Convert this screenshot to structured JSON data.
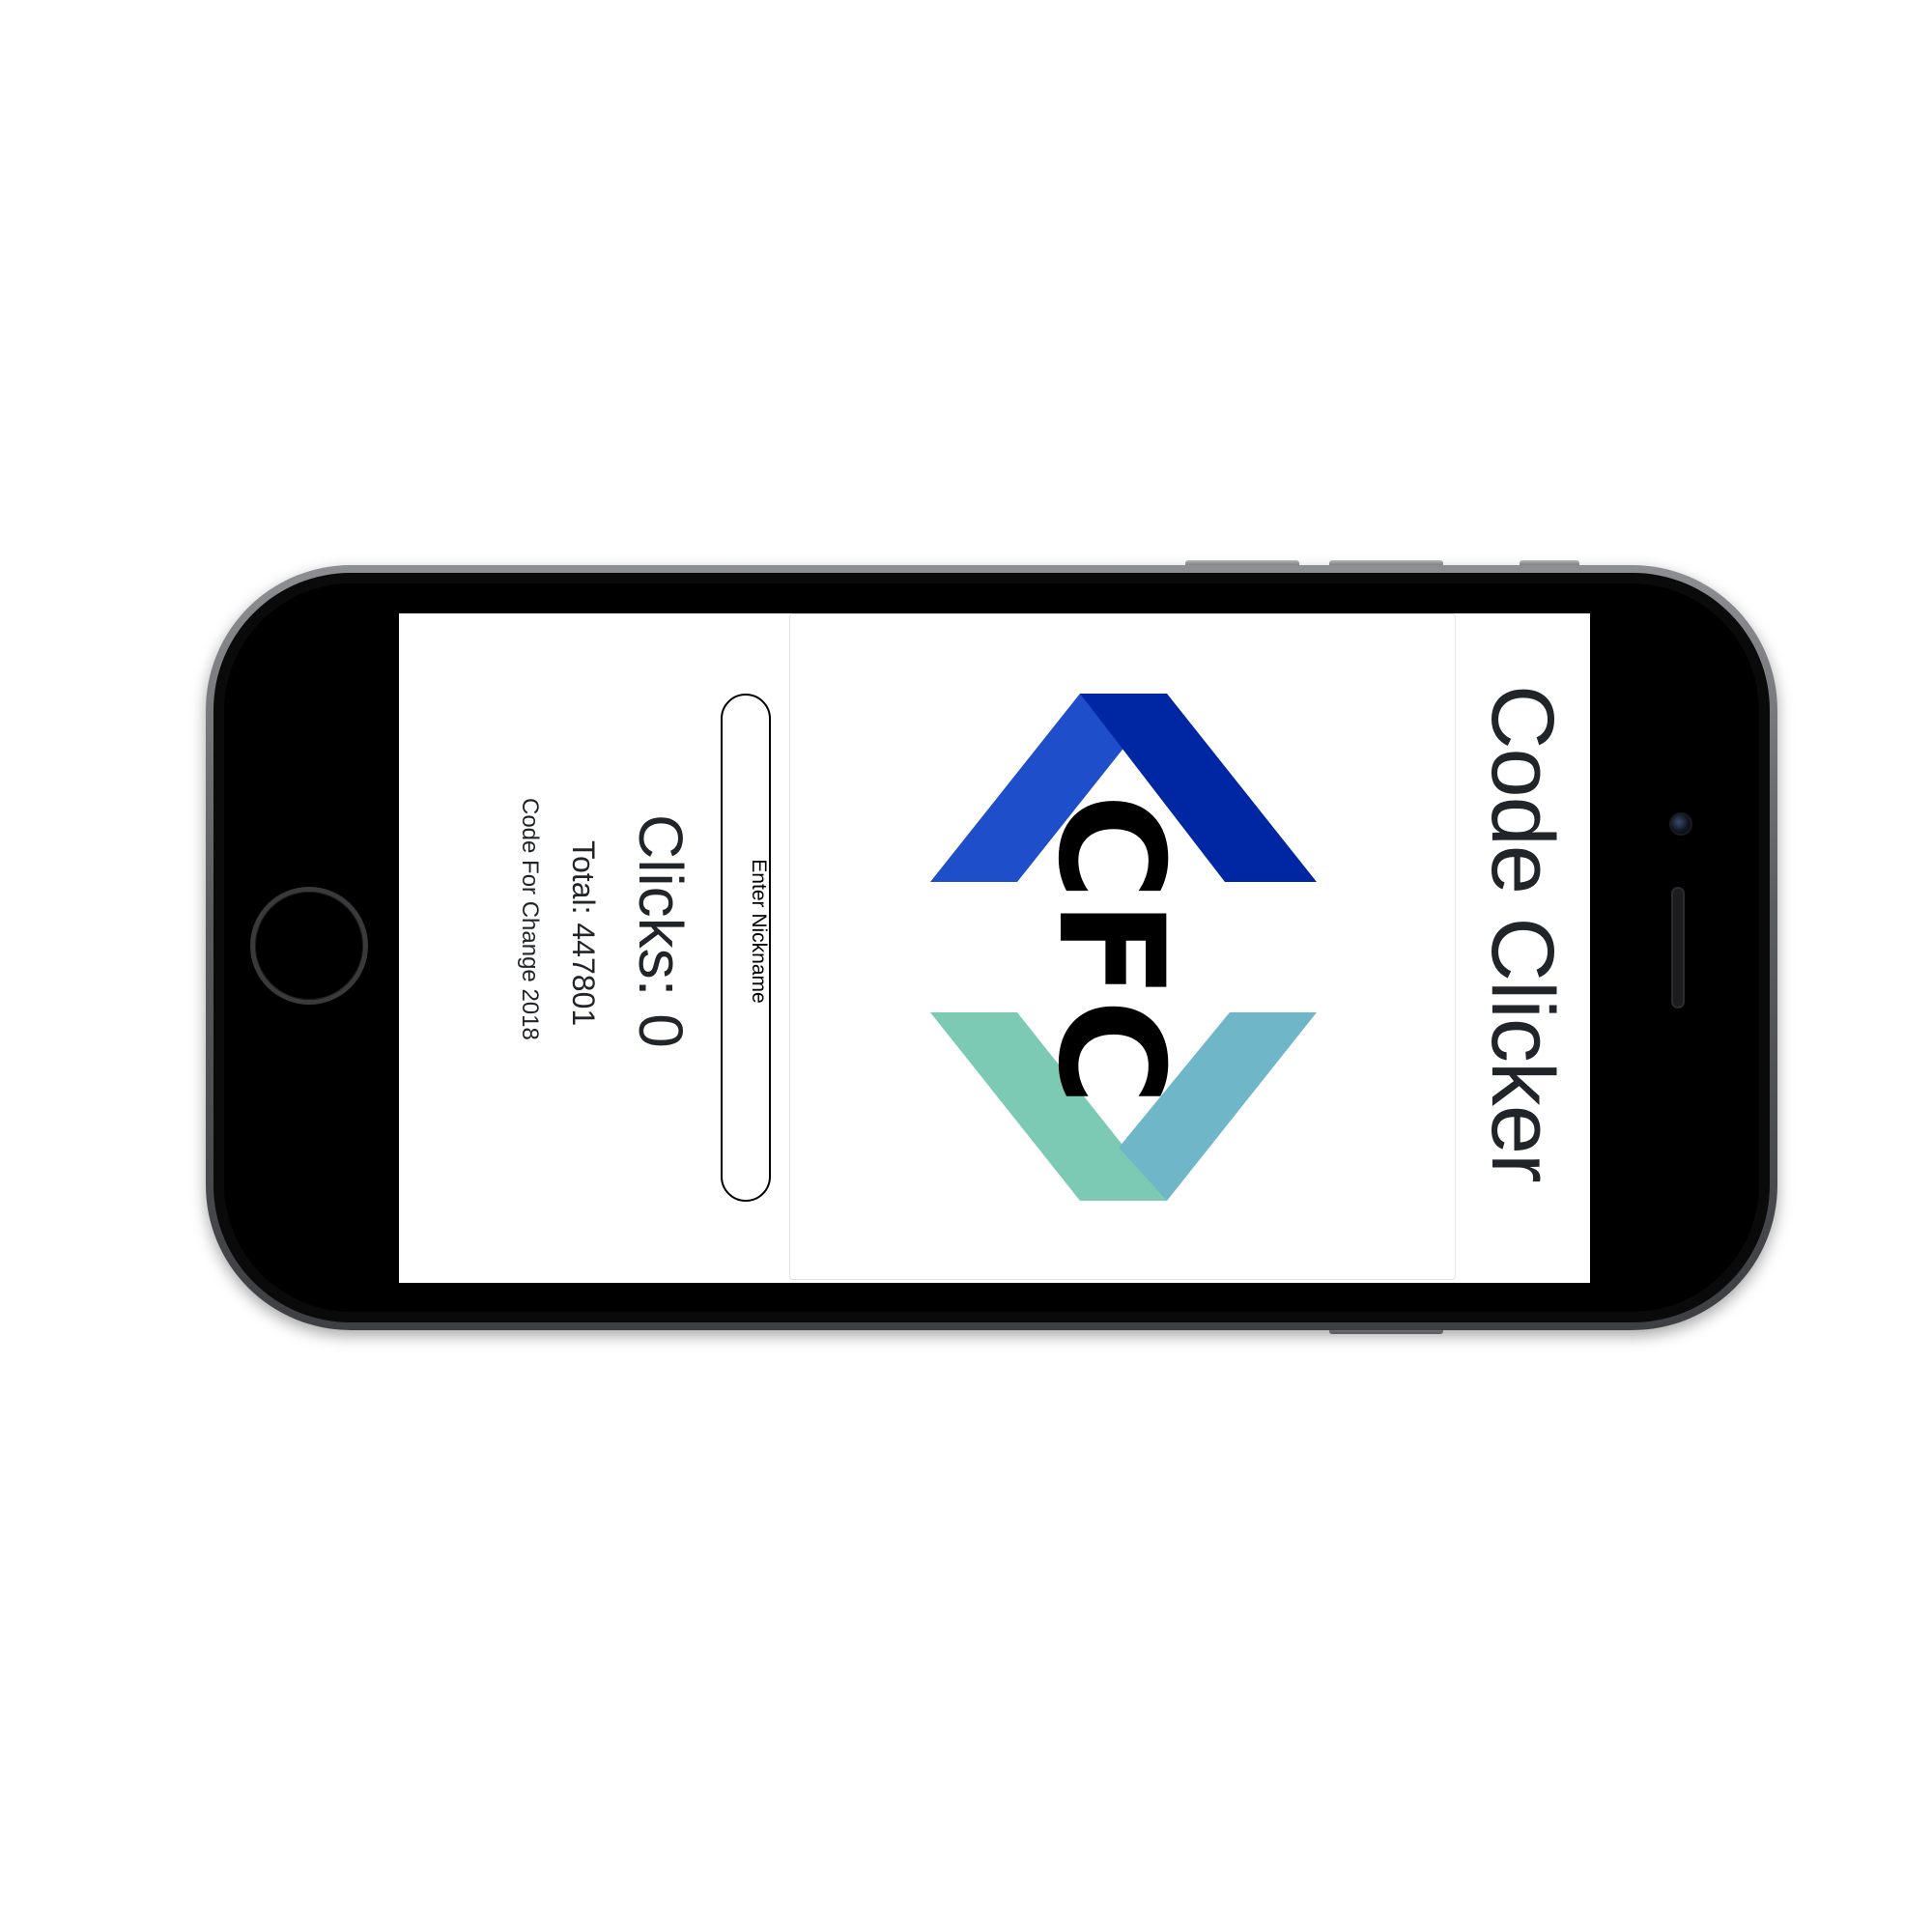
{
  "app": {
    "title": "Code Clicker"
  },
  "logo": {
    "text": "CFC",
    "colors": {
      "blue_light": "#1f4ecb",
      "blue_dark": "#0027a3",
      "green": "#7dcab4",
      "teal": "#6fb7c8",
      "text": "#000000"
    }
  },
  "controls": {
    "nickname_button_label": "Enter Nickname"
  },
  "stats": {
    "clicks_label": "Clicks: 0",
    "total_label": "Total: 447801"
  },
  "footer": {
    "text": "Code For Change 2018"
  }
}
